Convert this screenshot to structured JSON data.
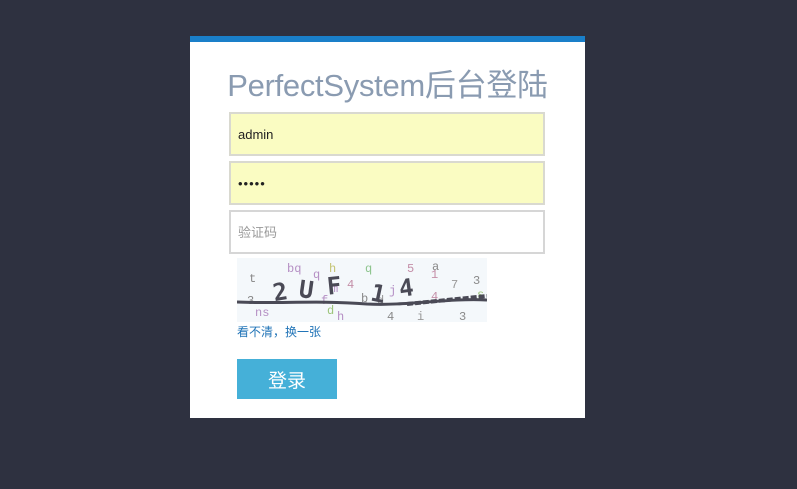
{
  "page": {
    "title": "PerfectSystem后台登陆"
  },
  "form": {
    "username_value": "admin",
    "password_value": "•••••",
    "captcha_placeholder": "验证码",
    "captcha_image": {
      "text": "2UF14",
      "icon": "captcha-image"
    },
    "refresh_link": "看不清，换一张",
    "login_button": "登录"
  },
  "colors": {
    "background": "#2e3140",
    "card": "#ffffff",
    "card_top_border": "#1a7fc9",
    "title": "#8a9bb1",
    "autofill": "#fafcc2",
    "button": "#45b0d8",
    "link": "#1f73b7"
  }
}
